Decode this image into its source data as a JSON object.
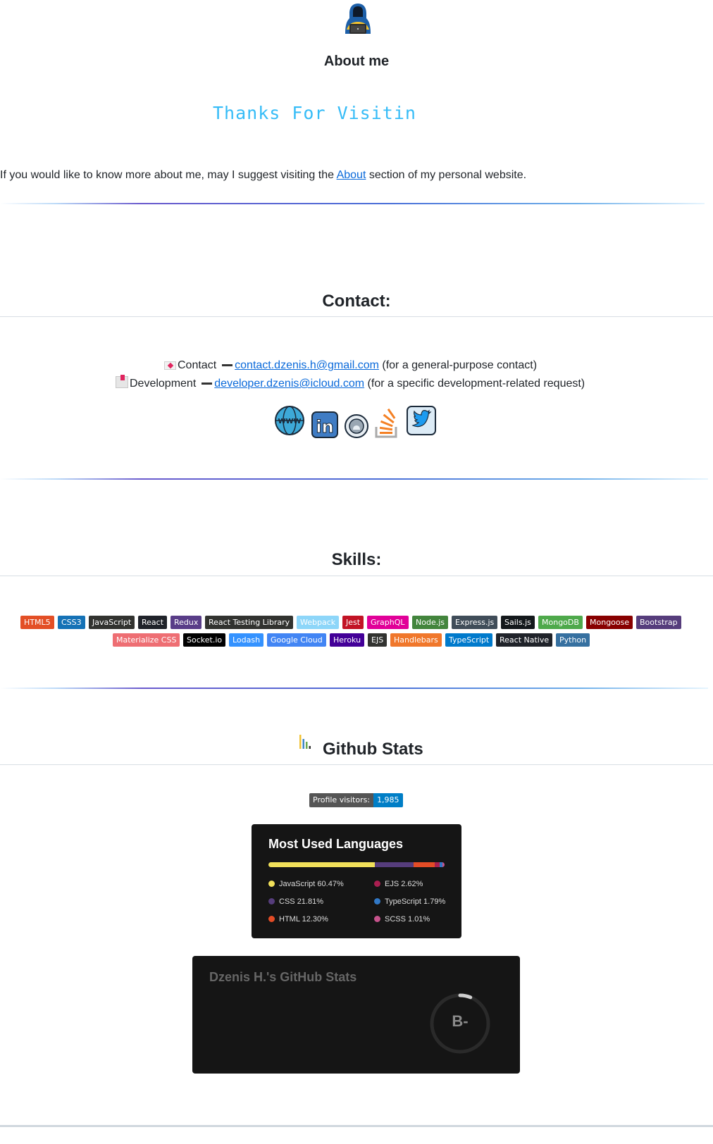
{
  "about": {
    "title": "About me",
    "typing_text": "Thanks For Visitin",
    "intro_before": "If you would like to know more about me, may I suggest visiting the ",
    "intro_link": "About",
    "intro_after": " section of my personal website."
  },
  "contact": {
    "title": "Contact:",
    "line1_label": "Contact",
    "line1_email": "contact.dzenis.h@gmail.com",
    "line1_note": " (for a general-purpose contact)",
    "line2_label": "Development",
    "line2_email": "developer.dzenis@icloud.com",
    "line2_note": " (for a specific development-related request)",
    "socials": [
      "globe-www-icon",
      "linkedin-icon",
      "github-icon",
      "stackoverflow-icon",
      "twitter-icon"
    ],
    "www_text": "WWW",
    "linkedin_text": "in"
  },
  "skills": {
    "title": "Skills:",
    "badges": [
      {
        "label": "HTML5",
        "color": "#e34f26"
      },
      {
        "label": "CSS3",
        "color": "#1572b6"
      },
      {
        "label": "JavaScript",
        "color": "#323330"
      },
      {
        "label": "React",
        "color": "#20232a"
      },
      {
        "label": "Redux",
        "color": "#593d88"
      },
      {
        "label": "React Testing Library",
        "color": "#323330"
      },
      {
        "label": "Webpack",
        "color": "#8dd6f9"
      },
      {
        "label": "Jest",
        "color": "#c21325"
      },
      {
        "label": "GraphQL",
        "color": "#e10098"
      },
      {
        "label": "Node.js",
        "color": "#43853d"
      },
      {
        "label": "Express.js",
        "color": "#404d59"
      },
      {
        "label": "Sails.js",
        "color": "#14191c"
      },
      {
        "label": "MongoDB",
        "color": "#4ea94b"
      },
      {
        "label": "Mongoose",
        "color": "#880000"
      },
      {
        "label": "Bootstrap",
        "color": "#563d7c"
      },
      {
        "label": "Materialize CSS",
        "color": "#ee6e73"
      },
      {
        "label": "Socket.io",
        "color": "#010101"
      },
      {
        "label": "Lodash",
        "color": "#3492ff"
      },
      {
        "label": "Google Cloud",
        "color": "#4285f4"
      },
      {
        "label": "Heroku",
        "color": "#430098"
      },
      {
        "label": "EJS",
        "color": "#323330"
      },
      {
        "label": "Handlebars",
        "color": "#f0772b"
      },
      {
        "label": "TypeScript",
        "color": "#007acc"
      },
      {
        "label": "React Native",
        "color": "#20232a"
      },
      {
        "label": "Python",
        "color": "#3670a0"
      }
    ]
  },
  "github": {
    "title": "Github Stats",
    "visitors_label": "Profile visitors:",
    "visitors_count": "1,985",
    "languages_title": "Most Used Languages",
    "languages": [
      {
        "name": "JavaScript",
        "percent": "60.47%",
        "value": 60.47,
        "color": "#f1e05a"
      },
      {
        "name": "CSS",
        "percent": "21.81%",
        "value": 21.81,
        "color": "#563d7c"
      },
      {
        "name": "HTML",
        "percent": "12.30%",
        "value": 12.3,
        "color": "#e34c26"
      },
      {
        "name": "EJS",
        "percent": "2.62%",
        "value": 2.62,
        "color": "#a91e50"
      },
      {
        "name": "TypeScript",
        "percent": "1.79%",
        "value": 1.79,
        "color": "#3178c6"
      },
      {
        "name": "SCSS",
        "percent": "1.01%",
        "value": 1.01,
        "color": "#c6538c"
      }
    ],
    "stats_title": "Dzenis H.'s GitHub Stats",
    "rank": "B-",
    "rank_progress": 0.06
  }
}
